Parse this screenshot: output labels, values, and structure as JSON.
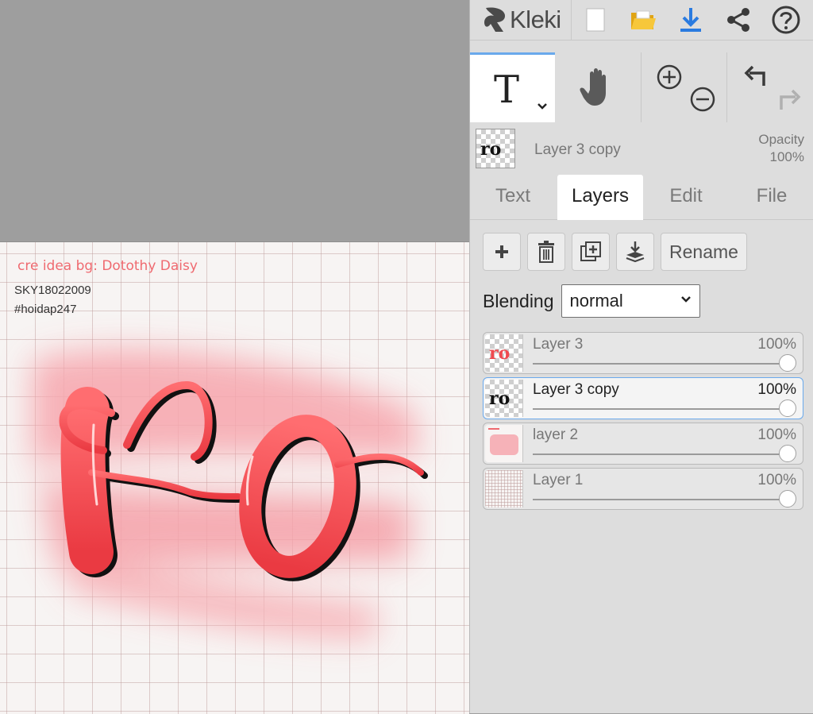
{
  "app": {
    "name": "Kleki"
  },
  "canvas": {
    "credit_text": "cre idea bg: Dotothy Daisy",
    "signature_line1": "SKY18022009",
    "signature_line2": "#hoidap247",
    "artwork_text": "ro"
  },
  "current_layer": {
    "name": "Layer 3 copy",
    "opacity_label": "Opacity",
    "opacity_value": "100%"
  },
  "tabs": [
    {
      "label": "Text",
      "active": false
    },
    {
      "label": "Layers",
      "active": true
    },
    {
      "label": "Edit",
      "active": false
    },
    {
      "label": "File",
      "active": false
    }
  ],
  "layer_actions": {
    "rename_label": "Rename"
  },
  "blending": {
    "label": "Blending",
    "value": "normal"
  },
  "layers": [
    {
      "name": "Layer 3",
      "opacity": "100%",
      "opacity_fraction": 1.0,
      "selected": false
    },
    {
      "name": "Layer 3 copy",
      "opacity": "100%",
      "opacity_fraction": 1.0,
      "selected": true
    },
    {
      "name": "layer 2",
      "opacity": "100%",
      "opacity_fraction": 1.0,
      "selected": false
    },
    {
      "name": "Layer 1",
      "opacity": "100%",
      "opacity_fraction": 1.0,
      "selected": false
    }
  ],
  "colors": {
    "accent": "#6aa9ec",
    "download": "#2a7be0",
    "folder": "#f2b824",
    "art_red": "#f04a4f",
    "credit_pink": "#ef6a70"
  },
  "icons": [
    "kleki-logo-icon",
    "new-file-icon",
    "open-folder-icon",
    "download-icon",
    "share-icon",
    "help-icon",
    "text-tool-icon",
    "chevron-down-icon",
    "hand-icon",
    "zoom-in-icon",
    "zoom-out-icon",
    "undo-icon",
    "redo-icon",
    "add-layer-icon",
    "delete-layer-icon",
    "duplicate-layer-icon",
    "merge-down-icon"
  ]
}
